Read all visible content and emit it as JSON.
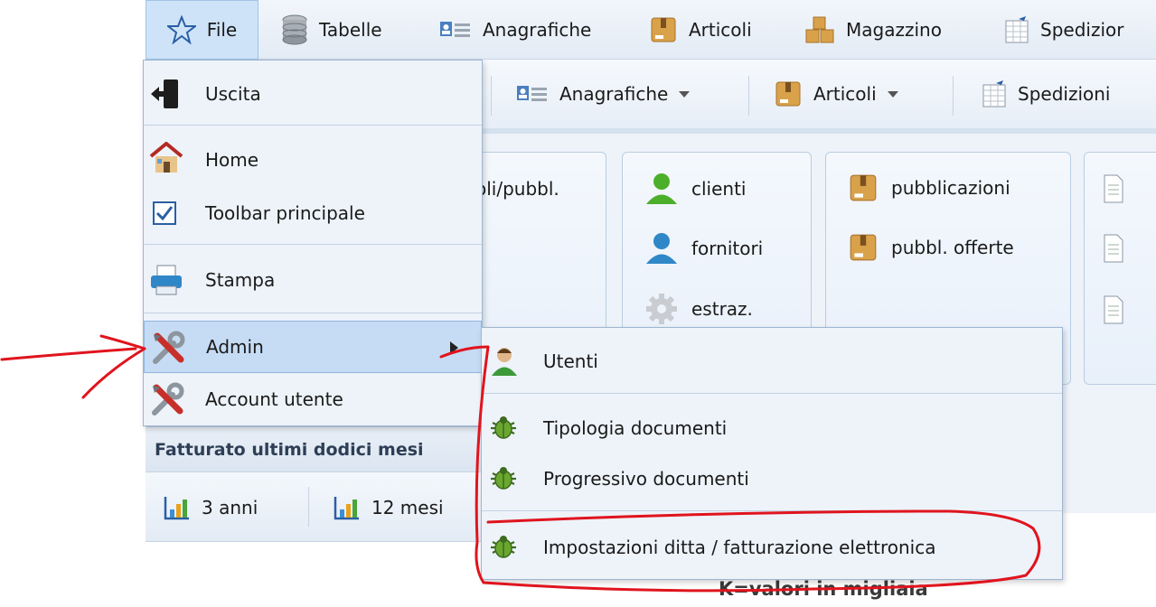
{
  "menubar": {
    "file": "File",
    "tabelle": "Tabelle",
    "anagrafiche": "Anagrafiche",
    "articoli": "Articoli",
    "magazzino": "Magazzino",
    "spedizioni": "Spedizior"
  },
  "toolbar": {
    "anagrafiche": "Anagrafiche",
    "articoli": "Articoli",
    "spedizioni": "Spedizioni"
  },
  "panels": {
    "articoli_partial": "oli/pubbl.",
    "clienti": "clienti",
    "fornitori": "fornitori",
    "estraz": "estraz.",
    "pubblicazioni": "pubblicazioni",
    "pubbl_offerte": "pubbl. offerte"
  },
  "fatturato": {
    "header": "Fatturato ultimi dodici mesi",
    "btn_3anni": "3 anni",
    "btn_12mesi": "12 mesi",
    "note": "K=valori in migliaia"
  },
  "file_menu": {
    "uscita": "Uscita",
    "home": "Home",
    "toolbar_principale": "Toolbar principale",
    "toolbar_checked": true,
    "stampa": "Stampa",
    "admin": "Admin",
    "account_utente": "Account utente"
  },
  "admin_menu": {
    "utenti": "Utenti",
    "tipologia_documenti": "Tipologia documenti",
    "progressivo_documenti": "Progressivo documenti",
    "impostazioni_ditta": "Impostazioni ditta / fatturazione elettronica"
  },
  "colors": {
    "annotation": "#e0141e",
    "menu_highlight": "#c6dcf4"
  },
  "icons": [
    "star-icon",
    "database-icon",
    "contact-card-icon",
    "box-icon",
    "boxes-icon",
    "calendar-icon",
    "exit-icon",
    "home-icon",
    "checkbox-icon",
    "printer-icon",
    "tools-icon",
    "user-icon",
    "gear-icon",
    "bug-icon",
    "bar-chart-icon",
    "document-icon"
  ]
}
